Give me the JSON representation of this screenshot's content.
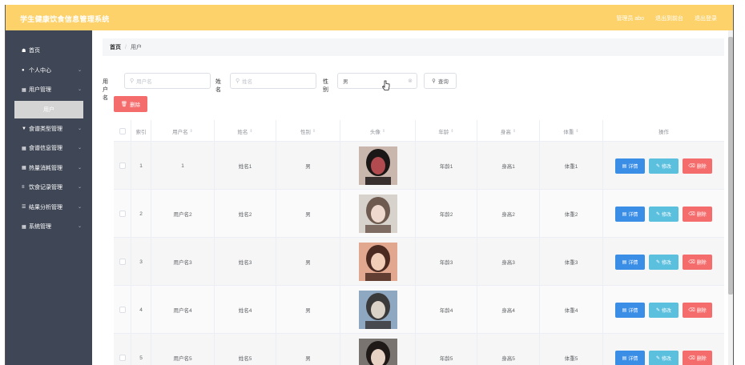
{
  "header": {
    "title": "学生健康饮食信息管理系统",
    "admin_label": "管理员 abo",
    "front_link": "退出到前台",
    "logout_link": "退出登录"
  },
  "sidebar": {
    "items": [
      {
        "label": "首页",
        "icon": "home-icon"
      },
      {
        "label": "个人中心",
        "icon": "user-icon"
      },
      {
        "label": "用户管理",
        "icon": "grid-icon"
      },
      {
        "label": "食谱类型管理",
        "icon": "shield-icon"
      },
      {
        "label": "食谱信息管理",
        "icon": "grid-icon"
      },
      {
        "label": "热量消耗管理",
        "icon": "grid-icon"
      },
      {
        "label": "饮食记录管理",
        "icon": "sliders-icon"
      },
      {
        "label": "结果分析管理",
        "icon": "list-icon"
      },
      {
        "label": "系统管理",
        "icon": "grid-icon"
      }
    ],
    "active_sub": "用户"
  },
  "breadcrumb": {
    "home": "首页",
    "current": "用户"
  },
  "search": {
    "username_label": "用户名",
    "username_placeholder": "用户名",
    "name_label": "姓名",
    "name_placeholder": "姓名",
    "gender_label": "性别",
    "gender_value": "男",
    "query_button": "查询"
  },
  "delete_button": "删除",
  "table": {
    "headers": {
      "index": "索引",
      "username": "用户名",
      "name": "姓名",
      "gender": "性别",
      "avatar": "头像",
      "age": "年龄",
      "height": "身高",
      "weight": "体重",
      "actions": "操作"
    },
    "rows": [
      {
        "index": "1",
        "username": "1",
        "name": "姓名1",
        "gender": "男",
        "age": "年龄1",
        "height": "身高1",
        "weight": "体重1"
      },
      {
        "index": "2",
        "username": "用户名2",
        "name": "姓名2",
        "gender": "男",
        "age": "年龄2",
        "height": "身高2",
        "weight": "体重2"
      },
      {
        "index": "3",
        "username": "用户名3",
        "name": "姓名3",
        "gender": "男",
        "age": "年龄3",
        "height": "身高3",
        "weight": "体重3"
      },
      {
        "index": "4",
        "username": "用户名4",
        "name": "姓名4",
        "gender": "男",
        "age": "年龄4",
        "height": "身高4",
        "weight": "体重4"
      },
      {
        "index": "5",
        "username": "用户名5",
        "name": "姓名5",
        "gender": "男",
        "age": "年龄5",
        "height": "身高5",
        "weight": "体重5"
      }
    ],
    "action_labels": {
      "detail": "详情",
      "edit": "修改",
      "delete": "删除"
    }
  },
  "colors": {
    "topbar": "#fdd26a",
    "sidebar": "#3f4655",
    "danger": "#f56c6c",
    "primary": "#3a8ee6",
    "info": "#5bc0de"
  }
}
